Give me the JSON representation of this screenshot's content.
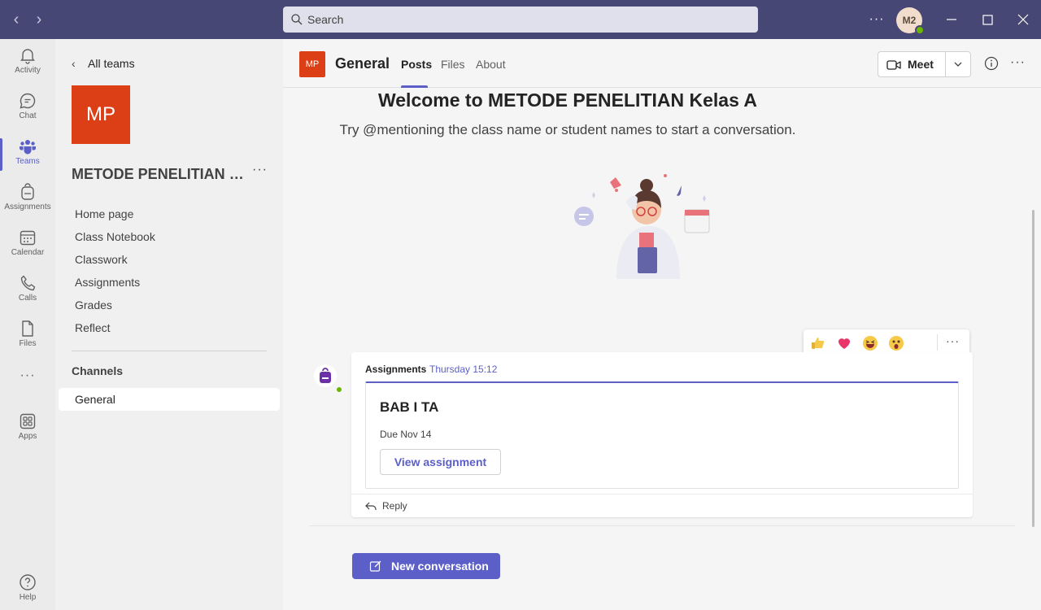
{
  "titlebar": {
    "search_placeholder": "Search",
    "avatar_initials": "M2"
  },
  "rail": {
    "activity": "Activity",
    "chat": "Chat",
    "teams": "Teams",
    "assignments": "Assignments",
    "calendar": "Calendar",
    "calls": "Calls",
    "files": "Files",
    "apps": "Apps",
    "help": "Help"
  },
  "sidebar": {
    "all_teams": "All teams",
    "team_initials": "MP",
    "team_name": "METODE PENELITIAN Kelas A",
    "menu": [
      "Home page",
      "Class Notebook",
      "Classwork",
      "Assignments",
      "Grades",
      "Reflect"
    ],
    "channels_heading": "Channels",
    "channels": [
      "General"
    ]
  },
  "header": {
    "team_initials": "MP",
    "channel_title": "General",
    "tabs": [
      "Posts",
      "Files",
      "About"
    ],
    "meet_label": "Meet"
  },
  "welcome": {
    "title": "Welcome to METODE PENELITIAN Kelas A",
    "subtitle": "Try @mentioning the class name or student names to start a conversation."
  },
  "post": {
    "author": "Assignments",
    "time": "Thursday 15:12",
    "card_title": "BAB I TA",
    "due": "Due Nov 14",
    "view_button": "View assignment",
    "reply": "Reply"
  },
  "reactions": [
    "thumbs-up-emoji",
    "heart-emoji",
    "laugh-emoji",
    "surprised-emoji"
  ],
  "new_conversation": "New conversation",
  "colors": {
    "titlebar": "#464775",
    "accent": "#5b5fc7",
    "team_tile": "#dc3e15"
  }
}
